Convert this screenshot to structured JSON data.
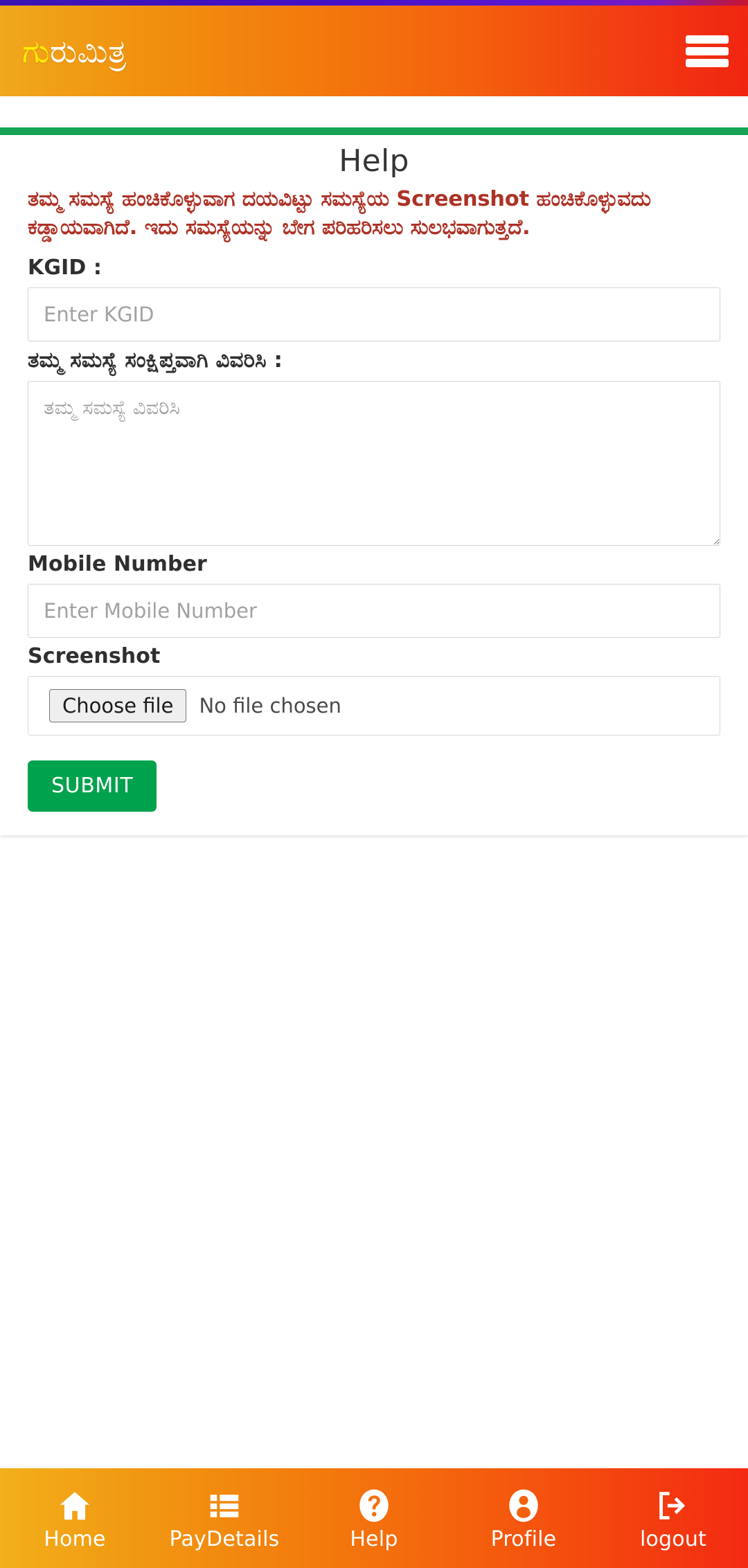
{
  "status_bar": {
    "accent_color": "#4411c6"
  },
  "appbar": {
    "brand_accent": "ಗು",
    "brand_rest": "ರುಮಿತ್ರ",
    "brand_full": "ಗುರುಮಿತ್ರ",
    "menu_icon": "hamburger-icon",
    "accent_start": "#f0a81c",
    "accent_end": "#f02511"
  },
  "card": {
    "accent_bar_color": "#15a356",
    "title": "Help",
    "alert": "ತಮ್ಮ ಸಮಸ್ಯೆ ಹಂಚಿಕೊಳ್ಳುವಾಗ ದಯವಿಟ್ಟು ಸಮಸ್ಯೆಯ Screenshot ಹಂಚಿಕೊಳ್ಳುವದು ಕಡ್ಡಾಯವಾಗಿದೆ. ಇದು ಸಮಸ್ಯೆಯನ್ನು ಬೇಗ ಪರಿಹರಿಸಲು ಸುಲಭವಾಗುತ್ತದೆ.",
    "alert_color": "#ad3226"
  },
  "form": {
    "kgid": {
      "label": "KGID :",
      "placeholder": "Enter KGID",
      "value": ""
    },
    "problem": {
      "label": "ತಮ್ಮ ಸಮಸ್ಯೆ ಸಂಕ್ಷಿಪ್ತವಾಗಿ ವಿವರಿಸಿ :",
      "placeholder": "ತಮ್ಮ ಸಮಸ್ಯೆ ವಿವರಿಸಿ",
      "value": ""
    },
    "mobile": {
      "label": "Mobile Number",
      "placeholder": "Enter Mobile Number",
      "value": ""
    },
    "screenshot": {
      "label": "Screenshot",
      "choose_label": "Choose file",
      "no_file_text": "No file chosen"
    },
    "submit_label": "SUBMIT",
    "submit_color": "#00a24d"
  },
  "bottom_nav": {
    "items": [
      {
        "label": "Home",
        "icon": "home-icon"
      },
      {
        "label": "PayDetails",
        "icon": "list-icon"
      },
      {
        "label": "Help",
        "icon": "question-circle-icon"
      },
      {
        "label": "Profile",
        "icon": "person-circle-icon"
      },
      {
        "label": "logout",
        "icon": "logout-icon"
      }
    ]
  }
}
